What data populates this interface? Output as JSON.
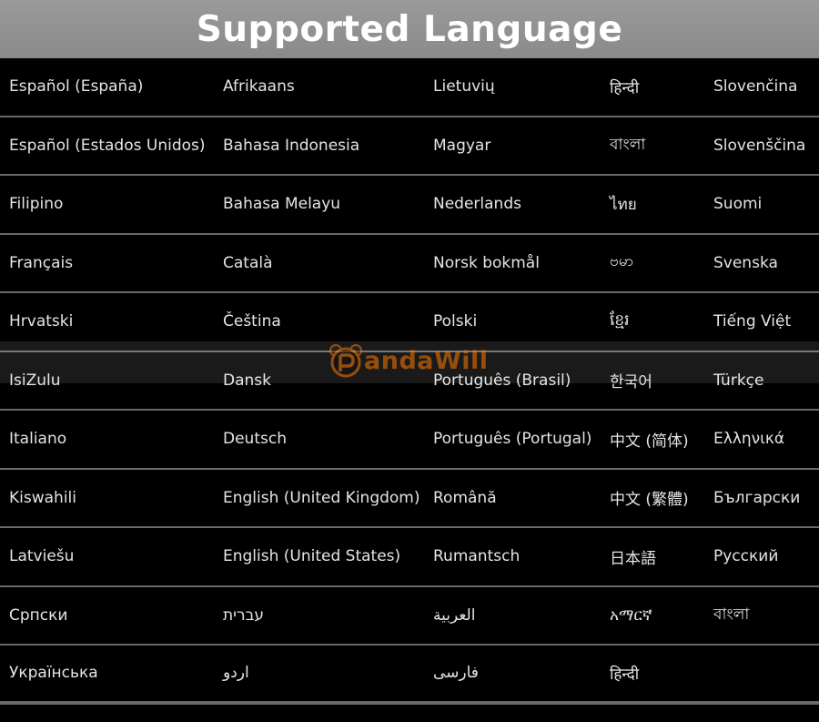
{
  "header": {
    "title": "Supported Language"
  },
  "watermark": {
    "text": "andaWill"
  },
  "rows": [
    [
      "Español (España)",
      "Afrikaans",
      "Lietuvių",
      "हिन्दी",
      "Slovenčina"
    ],
    [
      "Español (Estados Unidos)",
      "Bahasa Indonesia",
      "Magyar",
      "বাংলা",
      "Slovenščina"
    ],
    [
      "Filipino",
      "Bahasa Melayu",
      "Nederlands",
      "ไทย",
      "Suomi"
    ],
    [
      "Français",
      "Català",
      "Norsk bokmål",
      "ဗမာ",
      "Svenska"
    ],
    [
      "Hrvatski",
      "Čeština",
      "Polski",
      "ខ្មែរ",
      "Tiếng Việt"
    ],
    [
      "IsiZulu",
      "Dansk",
      "Português (Brasil)",
      "한국어",
      "Türkçe"
    ],
    [
      "Italiano",
      "Deutsch",
      "Português (Portugal)",
      "中文 (简体)",
      "Ελληνικά"
    ],
    [
      "Kiswahili",
      "English (United Kingdom)",
      "Română",
      "中文 (繁體)",
      "Български"
    ],
    [
      "Latviešu",
      "English (United States)",
      "Rumantsch",
      "日本語",
      "Русский"
    ],
    [
      "Српски",
      "עברית",
      "العربية",
      "አማርኛ",
      "বাংলা"
    ],
    [
      "Українська",
      "اردو",
      "فارسی",
      "हिन्दी",
      ""
    ]
  ]
}
